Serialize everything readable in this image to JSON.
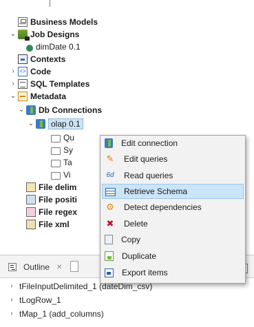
{
  "tree": {
    "business_models": "Business Models",
    "job_designs": "Job Designs",
    "dim_date": "dimDate 0.1",
    "contexts": "Contexts",
    "code": "Code",
    "sql_templates": "SQL Templates",
    "metadata": "Metadata",
    "db_connections": "Db Connections",
    "olap": "olap 0.1",
    "sub_folders": [
      "Qu",
      "Sy",
      "Ta",
      "Vi"
    ],
    "file_delim": "File delim",
    "file_positi": "File positi",
    "file_regex": "File regex",
    "file_xml": "File xml"
  },
  "context_menu": {
    "items": [
      {
        "label": "Edit connection",
        "icon": "db-connection-icon"
      },
      {
        "label": "Edit queries",
        "icon": "pencil-icon"
      },
      {
        "label": "Read queries",
        "icon": "read-queries-icon"
      },
      {
        "label": "Retrieve Schema",
        "icon": "table-icon",
        "highlighted": true
      },
      {
        "label": "Detect dependencies",
        "icon": "dependencies-icon"
      },
      {
        "label": "Delete",
        "icon": "delete-icon"
      },
      {
        "label": "Copy",
        "icon": "copy-icon"
      },
      {
        "label": "Duplicate",
        "icon": "duplicate-icon"
      },
      {
        "label": "Export items",
        "icon": "export-icon"
      }
    ],
    "highlight_color": "#cce4f7"
  },
  "outline": {
    "tab_label": "Outline",
    "close": "✕",
    "items": [
      "tFileInputDelimited_1 (dateDim_csv)",
      "tLogRow_1",
      "tMap_1 (add_columns)"
    ]
  },
  "glyphs": {
    "collapsed": "›",
    "expanded": "⌄"
  }
}
